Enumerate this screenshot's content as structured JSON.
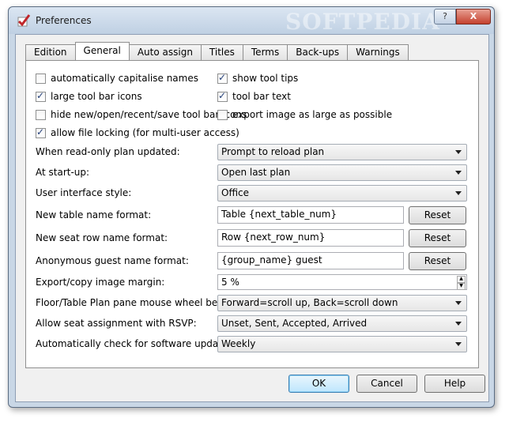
{
  "window": {
    "title": "Preferences",
    "watermark": "SOFTPEDIA",
    "help_glyph": "?",
    "close_glyph": "X"
  },
  "tabs": [
    {
      "label": "Edition"
    },
    {
      "label": "General",
      "active": true
    },
    {
      "label": "Auto assign"
    },
    {
      "label": "Titles"
    },
    {
      "label": "Terms"
    },
    {
      "label": "Back-ups"
    },
    {
      "label": "Warnings"
    }
  ],
  "checkboxes": {
    "capitalise": {
      "label": "automatically capitalise names",
      "checked": false
    },
    "show_tips": {
      "label": "show tool tips",
      "checked": true
    },
    "large_icons": {
      "label": "large tool bar icons",
      "checked": true
    },
    "toolbar_text": {
      "label": "tool bar text",
      "checked": true
    },
    "hide_icons": {
      "label": "hide new/open/recent/save tool bar icons",
      "checked": false
    },
    "export_large": {
      "label": "export image as large as possible",
      "checked": false
    },
    "file_locking": {
      "label": "allow file locking (for multi-user access)",
      "checked": true
    }
  },
  "settings": {
    "readonly": {
      "label": "When read-only plan updated:",
      "value": "Prompt to reload plan"
    },
    "startup": {
      "label": "At start-up:",
      "value": "Open last plan"
    },
    "ui_style": {
      "label": "User interface style:",
      "value": "Office"
    },
    "table_name": {
      "label": "New table name format:",
      "value": "Table {next_table_num}",
      "reset": "Reset"
    },
    "seat_row": {
      "label": "New seat row name format:",
      "value": "Row {next_row_num}",
      "reset": "Reset"
    },
    "guest_name": {
      "label": "Anonymous guest name format:",
      "value": "{group_name} guest",
      "reset": "Reset"
    },
    "margin": {
      "label": "Export/copy image margin:",
      "value": "5 %"
    },
    "wheel": {
      "label": "Floor/Table Plan pane mouse wheel behaviour:",
      "value": "Forward=scroll up, Back=scroll down"
    },
    "rsvp": {
      "label": "Allow seat assignment with RSVP:",
      "value": "Unset, Sent, Accepted, Arrived"
    },
    "updates": {
      "label": "Automatically check for software updates:",
      "value": "Weekly"
    }
  },
  "buttons": {
    "ok": "OK",
    "cancel": "Cancel",
    "help": "Help"
  }
}
